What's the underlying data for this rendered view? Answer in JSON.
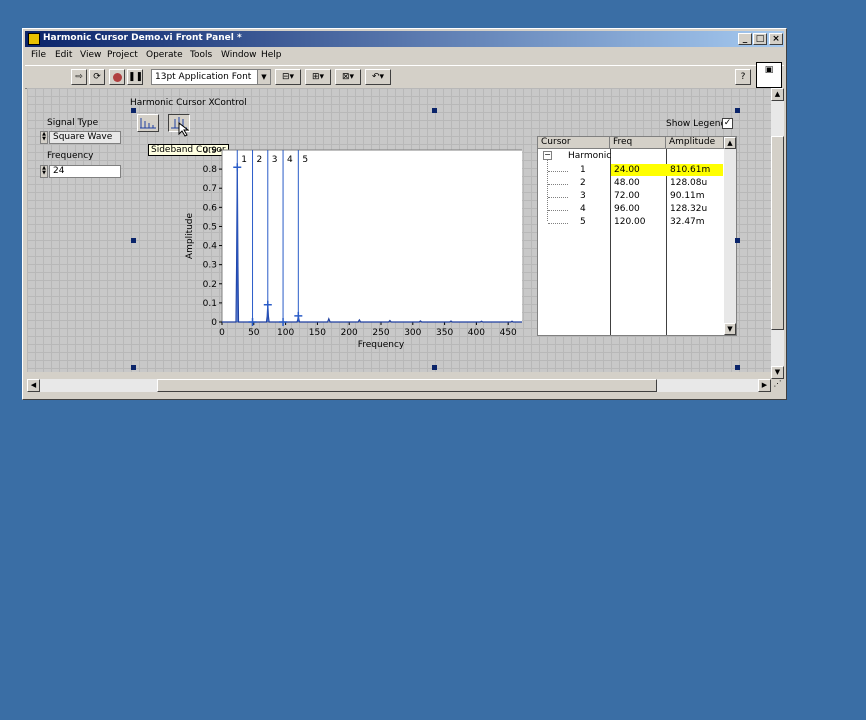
{
  "window": {
    "title": "Harmonic Cursor Demo.vi Front Panel *",
    "min_label": "_",
    "max_label": "□",
    "close_label": "×"
  },
  "menu": [
    "File",
    "Edit",
    "View",
    "Project",
    "Operate",
    "Tools",
    "Window",
    "Help"
  ],
  "toolbar": {
    "font": "13pt Application Font"
  },
  "controls": {
    "signal_type_label": "Signal Type",
    "signal_type_value": "Square Wave",
    "frequency_label": "Frequency",
    "frequency_value": "24",
    "xcontrol_label": "Harmonic Cursor XControl",
    "tooltip": "Sideband Cursor",
    "show_legend_label": "Show Legend",
    "show_legend_checked": true
  },
  "tree": {
    "headers": [
      "Cursor",
      "Freq",
      "Amplitude"
    ],
    "group": "Harmonic",
    "rows": [
      {
        "cursor": "1",
        "freq": "24.00",
        "amp": "810.61m"
      },
      {
        "cursor": "2",
        "freq": "48.00",
        "amp": "128.08u"
      },
      {
        "cursor": "3",
        "freq": "72.00",
        "amp": "90.11m"
      },
      {
        "cursor": "4",
        "freq": "96.00",
        "amp": "128.32u"
      },
      {
        "cursor": "5",
        "freq": "120.00",
        "amp": "32.47m"
      }
    ]
  },
  "chart_data": {
    "type": "line",
    "xlabel": "Frequency",
    "ylabel": "Amplitude",
    "xlim": [
      0,
      500
    ],
    "ylim": [
      0,
      0.9
    ],
    "xticks": [
      "0",
      "50",
      "100",
      "150",
      "200",
      "250",
      "300",
      "350",
      "400",
      "450",
      "500"
    ],
    "yticks": [
      "0",
      "0.1",
      "0.2",
      "0.3",
      "0.4",
      "0.5",
      "0.6",
      "0.7",
      "0.8",
      "0.9"
    ],
    "x": [
      0,
      22,
      23,
      24,
      25,
      26,
      70,
      71,
      72,
      73,
      74,
      118,
      119,
      120,
      121,
      122,
      166,
      168,
      170,
      214,
      216,
      218,
      262,
      264,
      266,
      310,
      312,
      314,
      358,
      360,
      362,
      406,
      408,
      410,
      454,
      456,
      458,
      500
    ],
    "y": [
      0,
      0,
      0.3,
      0.81,
      0.3,
      0,
      0,
      0.03,
      0.09,
      0.03,
      0,
      0,
      0.01,
      0.032,
      0.01,
      0,
      0,
      0.017,
      0,
      0,
      0.011,
      0,
      0,
      0.008,
      0,
      0,
      0.006,
      0,
      0,
      0.005,
      0,
      0,
      0.004,
      0,
      0,
      0.004,
      0,
      0
    ],
    "cursors": [
      {
        "label": "1",
        "x": 24,
        "y": 0.81
      },
      {
        "label": "2",
        "x": 48,
        "y": 0
      },
      {
        "label": "3",
        "x": 72,
        "y": 0.09
      },
      {
        "label": "4",
        "x": 96,
        "y": 0
      },
      {
        "label": "5",
        "x": 120,
        "y": 0.032
      }
    ],
    "line_color": "#1f3fa0",
    "cursor_color": "#2a5cc8"
  }
}
